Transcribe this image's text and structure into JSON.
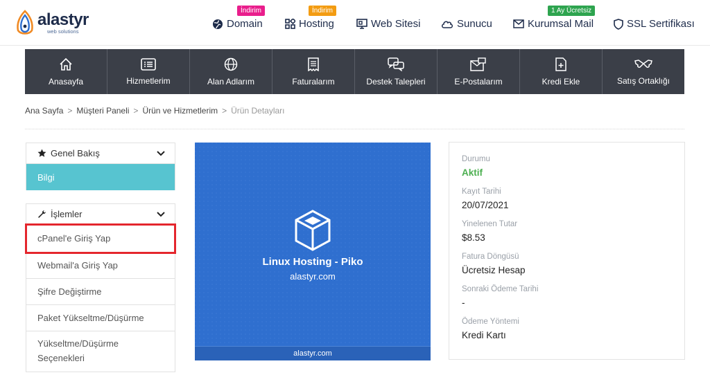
{
  "brand": {
    "name": "alastyr",
    "tagline": "web solutions"
  },
  "topnav": [
    {
      "label": "Domain",
      "badge": "İndirim",
      "badge_color": "#e91e8c"
    },
    {
      "label": "Hosting",
      "badge": "İndirim",
      "badge_color": "#f39c12"
    },
    {
      "label": "Web Sitesi"
    },
    {
      "label": "Sunucu"
    },
    {
      "label": "Kurumsal Mail",
      "badge": "1 Ay Ücretsiz",
      "badge_color": "#2ea44f"
    },
    {
      "label": "SSL Sertifikası"
    }
  ],
  "mainnav": [
    {
      "label": "Anasayfa",
      "icon": "home-icon"
    },
    {
      "label": "Hizmetlerim",
      "icon": "list-icon"
    },
    {
      "label": "Alan Adlarım",
      "icon": "globe-icon"
    },
    {
      "label": "Faturalarım",
      "icon": "invoice-icon"
    },
    {
      "label": "Destek Talepleri",
      "icon": "chat-icon"
    },
    {
      "label": "E-Postalarım",
      "icon": "mail-icon"
    },
    {
      "label": "Kredi Ekle",
      "icon": "file-plus-icon"
    },
    {
      "label": "Satış Ortaklığı",
      "icon": "handshake-icon"
    }
  ],
  "breadcrumb": [
    "Ana Sayfa",
    "Müşteri Paneli",
    "Ürün ve Hizmetlerim",
    "Ürün Detayları"
  ],
  "overview_panel": {
    "title": "Genel Bakış",
    "items": [
      "Bilgi"
    ]
  },
  "actions_panel": {
    "title": "İşlemler",
    "items": [
      "cPanel'e Giriş Yap",
      "Webmail'a Giriş Yap",
      "Şifre Değiştirme",
      "Paket Yükseltme/Düşürme",
      "Yükseltme/Düşürme Seçenekleri"
    ]
  },
  "product": {
    "name": "Linux Hosting - Piko",
    "domain": "alastyr.com",
    "footer": "alastyr.com"
  },
  "details": [
    {
      "label": "Durumu",
      "value": "Aktif",
      "status": "active"
    },
    {
      "label": "Kayıt Tarihi",
      "value": "20/07/2021"
    },
    {
      "label": "Yinelenen Tutar",
      "value": "$8.53"
    },
    {
      "label": "Fatura Döngüsü",
      "value": "Ücretsiz Hesap"
    },
    {
      "label": "Sonraki Ödeme Tarihi",
      "value": "-"
    },
    {
      "label": "Ödeme Yöntemi",
      "value": "Kredi Kartı"
    }
  ],
  "colors": {
    "nav_bg": "#3b3f48",
    "active_item": "#57c4d0",
    "product_bg": "#2f6fcf",
    "status_active": "#4caf50",
    "highlight": "#e4262d"
  }
}
